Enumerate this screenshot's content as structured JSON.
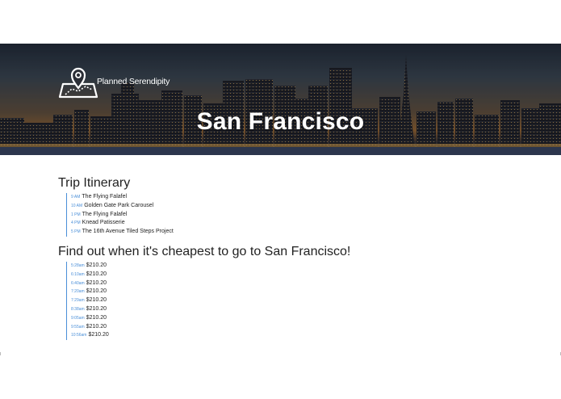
{
  "header": {
    "brand": "Planned Serendipity",
    "city": "San Francisco"
  },
  "itinerary": {
    "title": "Trip Itinerary",
    "items": [
      {
        "time": "9 AM",
        "place": "The Flying Falafel"
      },
      {
        "time": "10 AM",
        "place": "Golden Gate Park Carousel"
      },
      {
        "time": "1 PM",
        "place": "The Flying Falafel"
      },
      {
        "time": "4 PM",
        "place": "Knead Patisserie"
      },
      {
        "time": "5 PM",
        "place": "The 16th Avenue Tiled Steps Project"
      }
    ]
  },
  "prices": {
    "title": "Find out when it's cheapest to go to San Francisco!",
    "items": [
      {
        "time": "5:28am",
        "price": "$210.20"
      },
      {
        "time": "6:10am",
        "price": "$210.20"
      },
      {
        "time": "6:40am",
        "price": "$210.20"
      },
      {
        "time": "7:20am",
        "price": "$210.20"
      },
      {
        "time": "7:29am",
        "price": "$210.20"
      },
      {
        "time": "8:38am",
        "price": "$210.20"
      },
      {
        "time": "9:05am",
        "price": "$210.20"
      },
      {
        "time": "9:55am",
        "price": "$210.20"
      },
      {
        "time": "10:56am",
        "price": "$210.20"
      }
    ]
  },
  "colors": {
    "accent": "#4a8fd8",
    "hero_overlay_text": "#ffffff"
  }
}
